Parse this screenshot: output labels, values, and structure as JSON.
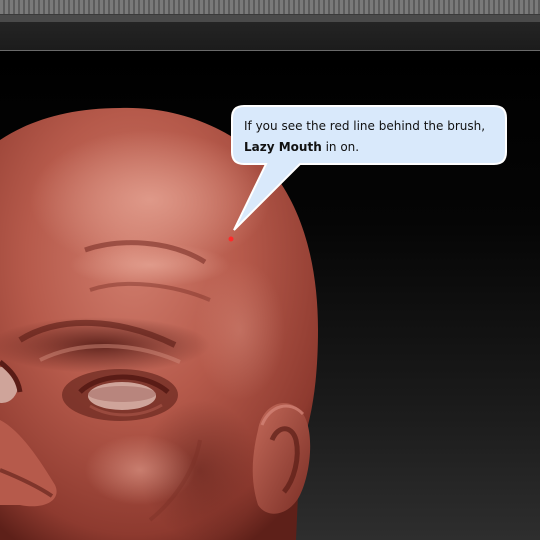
{
  "tooltip": {
    "line1": "If you see the red line behind the brush,",
    "emphasis": "Lazy Mouth",
    "line2_rest": " in on."
  },
  "colors": {
    "skin_base": "#b4584a",
    "skin_light": "#cf7e6e",
    "skin_shadow": "#6e2a22",
    "bubble_fill": "#d9e9fb",
    "bubble_border": "#ffffff",
    "brush_dot": "#ff2a2a"
  },
  "icons": {
    "brush_cursor": "red-dot-icon"
  }
}
